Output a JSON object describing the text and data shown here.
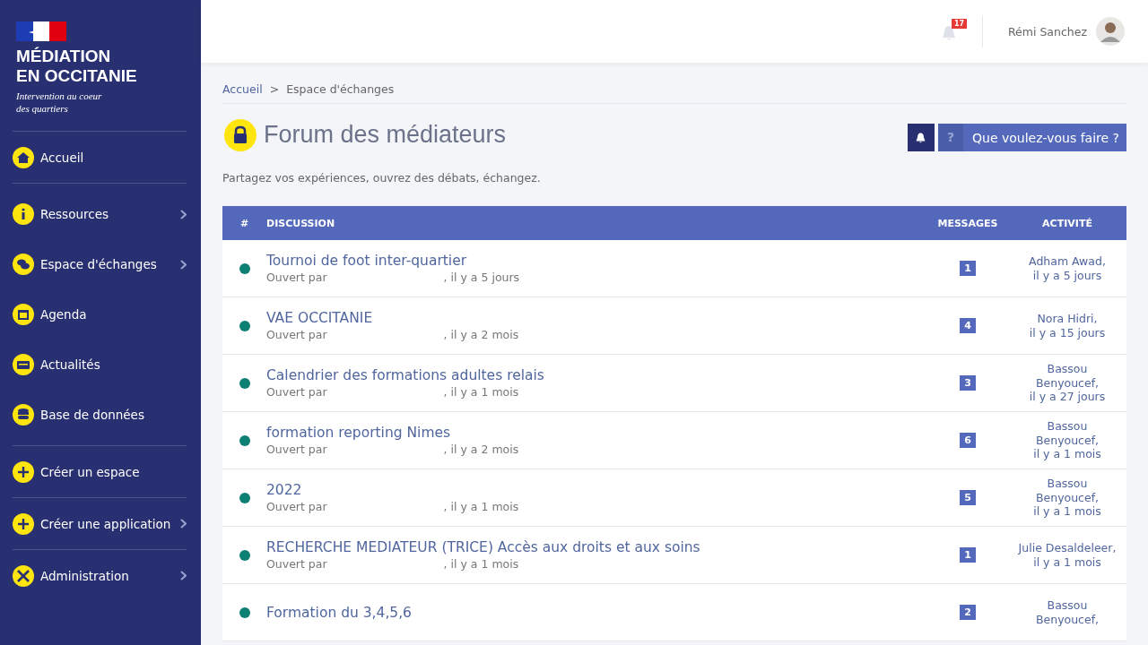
{
  "brand": {
    "title_lines": [
      "MÉDIATION",
      "EN OCCITANIE"
    ],
    "tagline_lines": [
      "Intervention au coeur",
      "des quartiers"
    ]
  },
  "sidebar": {
    "sections": [
      [
        {
          "label": "Accueil",
          "expandable": false
        }
      ],
      [
        {
          "label": "Ressources",
          "expandable": true
        },
        {
          "label": "Espace d'échanges",
          "expandable": true
        },
        {
          "label": "Agenda",
          "expandable": false
        },
        {
          "label": "Actualités",
          "expandable": false
        },
        {
          "label": "Base de données",
          "expandable": false
        }
      ],
      [
        {
          "label": "Créer un espace",
          "expandable": false
        }
      ],
      [
        {
          "label": "Créer une application",
          "expandable": true
        }
      ],
      [
        {
          "label": "Administration",
          "expandable": true
        }
      ]
    ]
  },
  "topbar": {
    "notification_count": "17",
    "user_name": "Rémi Sanchez"
  },
  "breadcrumb": [
    {
      "label": "Accueil",
      "link": true
    },
    {
      "label": "Espace d'échanges",
      "link": false
    }
  ],
  "breadcrumb_separator": ">",
  "page": {
    "title": "Forum des médiateurs",
    "subtitle": "Partagez vos expériences, ouvrez des débats, échangez.",
    "help_button": "Que voulez-vous faire ?",
    "help_glyph": "?"
  },
  "table": {
    "columns": [
      "#",
      "DISCUSSION",
      "MESSAGES",
      "ACTIVITÉ"
    ],
    "rows": [
      {
        "unread": true,
        "title": "Tournoi de foot inter-quartier",
        "opened_by": "Ouvert par",
        "opened_when": ", il y a 5 jours",
        "messages": "1",
        "activity": [
          "Adham Awad,",
          "il y a 5 jours"
        ]
      },
      {
        "unread": true,
        "title": "VAE OCCITANIE",
        "opened_by": "Ouvert par",
        "opened_when": ", il y a 2 mois",
        "messages": "4",
        "activity": [
          "Nora Hidri,",
          "il y a 15 jours"
        ]
      },
      {
        "unread": true,
        "title": "Calendrier des formations adultes relais",
        "opened_by": "Ouvert par",
        "opened_when": ", il y a 1 mois",
        "messages": "3",
        "activity": [
          "Bassou",
          "Benyoucef,",
          "il y a 27 jours"
        ]
      },
      {
        "unread": true,
        "title": "formation reporting Nimes",
        "opened_by": "Ouvert par",
        "opened_when": ", il y a 2 mois",
        "messages": "6",
        "activity": [
          "Bassou",
          "Benyoucef,",
          "il y a 1 mois"
        ]
      },
      {
        "unread": true,
        "title": "2022",
        "opened_by": "Ouvert par",
        "opened_when": ", il y a 1 mois",
        "messages": "5",
        "activity": [
          "Bassou",
          "Benyoucef,",
          "il y a 1 mois"
        ]
      },
      {
        "unread": true,
        "title": "RECHERCHE MEDIATEUR (TRICE) Accès aux droits et aux soins",
        "opened_by": "Ouvert par",
        "opened_when": ", il y a 1 mois",
        "messages": "1",
        "activity": [
          "Julie Desaldeleer,",
          "il y a 1 mois"
        ]
      },
      {
        "unread": true,
        "title": "Formation du 3,4,5,6",
        "messages": "2",
        "activity": [
          "Bassou",
          "Benyoucef,"
        ]
      }
    ]
  }
}
